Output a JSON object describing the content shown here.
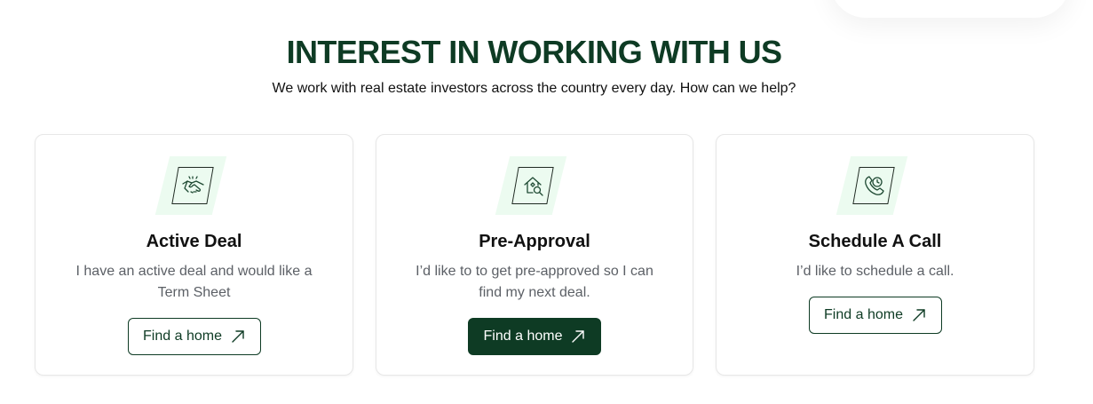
{
  "header": {
    "title": "INTEREST IN WORKING WITH US",
    "subtitle": "We work with real estate investors across the country every day. How can we help?"
  },
  "cards": [
    {
      "icon": "handshake-icon",
      "title": "Active Deal",
      "description": "I have an active deal and would like a Term Sheet",
      "button_label": "Find a home",
      "button_style": "outline"
    },
    {
      "icon": "house-search-icon",
      "title": "Pre-Approval",
      "description": "I’d like to to get pre-approved so I can find my next deal.",
      "button_label": "Find a home",
      "button_style": "filled"
    },
    {
      "icon": "phone-clock-icon",
      "title": "Schedule A Call",
      "description": "I’d like to schedule a call.",
      "button_label": "Find a home",
      "button_style": "outline"
    }
  ],
  "colors": {
    "brand_green": "#0e3b24",
    "icon_bg": "#ecfbf0",
    "muted_text": "#5c6066"
  }
}
